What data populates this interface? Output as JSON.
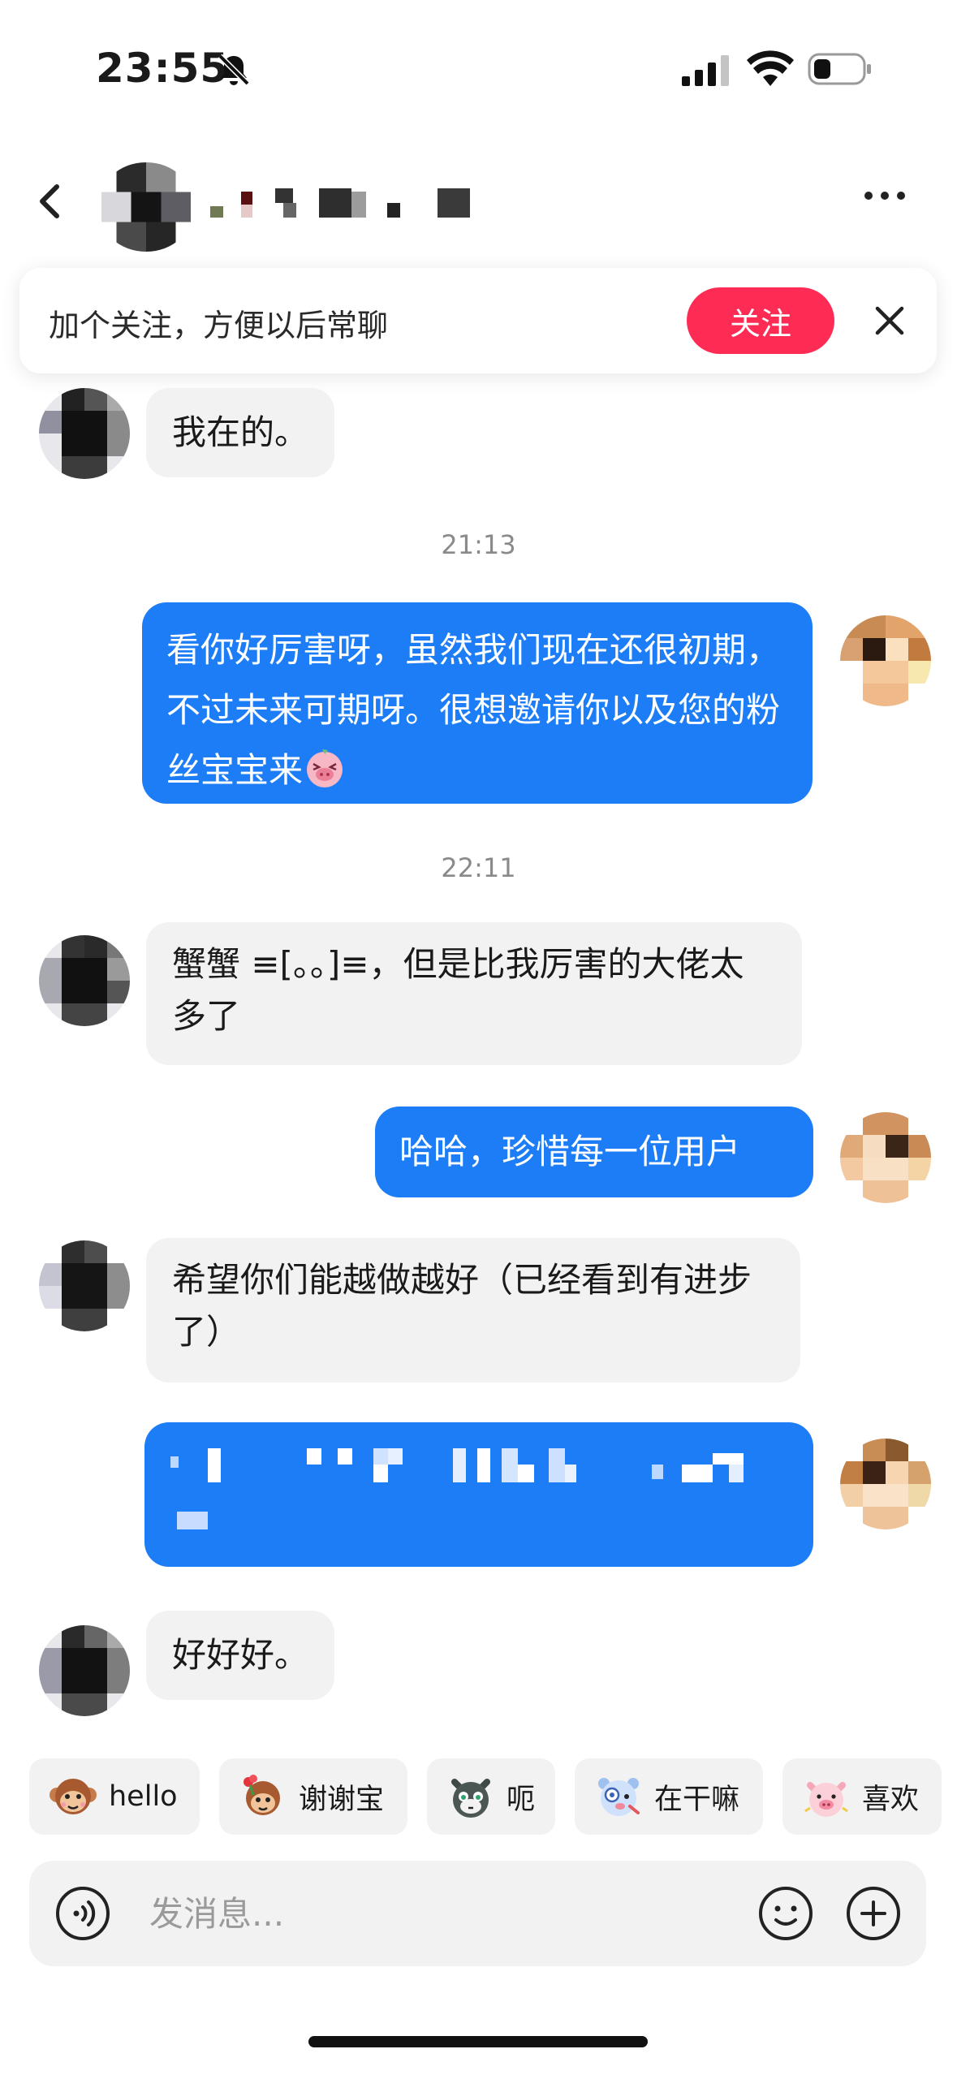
{
  "status_bar": {
    "time": "23:55",
    "icons": [
      "bell-off-icon",
      "signal-icon",
      "wifi-icon",
      "battery-icon"
    ]
  },
  "header": {
    "icons": [
      "back-icon",
      "more-icon"
    ]
  },
  "follow_banner": {
    "text": "加个关注，方便以后常聊",
    "follow_label": "关注",
    "close_icon": "close-icon"
  },
  "messages": [
    {
      "side": "in",
      "text": "我在的。"
    },
    {
      "type": "time",
      "text": "21:13"
    },
    {
      "side": "out",
      "text": "看你好厉害呀，虽然我们现在还很初期，不过未来可期呀。很想邀请你以及您的粉丝宝宝来",
      "trailing_emoji": "shy-pig-emoji"
    },
    {
      "type": "time",
      "text": "22:11"
    },
    {
      "side": "in",
      "text": "蟹蟹 ≡[。。]≡，但是比我厉害的大佬太多了"
    },
    {
      "side": "out",
      "text": "哈哈，珍惜每一位用户"
    },
    {
      "side": "in",
      "text": "希望你们能越做越好（已经看到有进步了）"
    },
    {
      "side": "out",
      "text": ""
    },
    {
      "side": "in",
      "text": "好好好。"
    }
  ],
  "quick_replies": [
    {
      "label": "hello",
      "icon": "monkey-sticker-icon"
    },
    {
      "label": "谢谢宝",
      "icon": "monkey-flower-sticker-icon"
    },
    {
      "label": "呃",
      "icon": "cat-sticker-icon"
    },
    {
      "label": "在干嘛",
      "icon": "bear-sticker-icon"
    },
    {
      "label": "喜欢",
      "icon": "pig-sticker-icon"
    }
  ],
  "input_bar": {
    "placeholder": "发消息...",
    "value": "",
    "icons": [
      "voice-icon",
      "emoji-icon",
      "plus-icon"
    ]
  },
  "colors": {
    "accent_follow": "#fe2c55",
    "outgoing_bubble": "#1c7df6",
    "incoming_bubble": "#f2f2f2"
  }
}
